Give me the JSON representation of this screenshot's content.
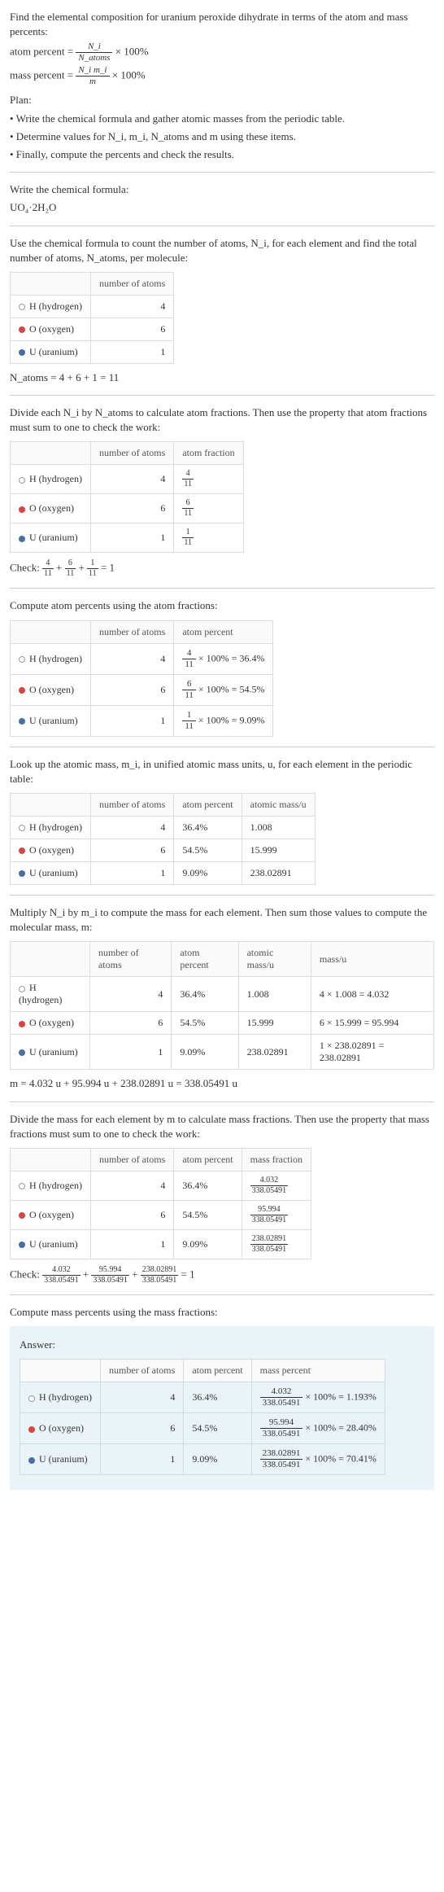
{
  "intro": {
    "prompt": "Find the elemental composition for uranium peroxide dihydrate in terms of the atom and mass percents:",
    "atom_eq_label": "atom percent = ",
    "atom_eq_num": "N_i",
    "atom_eq_den": "N_atoms",
    "times100": " × 100%",
    "mass_eq_label": "mass percent = ",
    "mass_eq_num": "N_i m_i",
    "mass_eq_den": "m"
  },
  "plan": {
    "heading": "Plan:",
    "b1": "• Write the chemical formula and gather atomic masses from the periodic table.",
    "b2": "• Determine values for N_i, m_i, N_atoms and m using these items.",
    "b3": "• Finally, compute the percents and check the results."
  },
  "step1": {
    "heading": "Write the chemical formula:",
    "formula": "UO₄·2H₂O"
  },
  "step2": {
    "text": "Use the chemical formula to count the number of atoms, N_i, for each element and find the total number of atoms, N_atoms, per molecule:",
    "col1": "number of atoms",
    "h_label": "H (hydrogen)",
    "o_label": "O (oxygen)",
    "u_label": "U (uranium)",
    "h_n": "4",
    "o_n": "6",
    "u_n": "1",
    "sum": "N_atoms = 4 + 6 + 1 = 11"
  },
  "step3": {
    "text": "Divide each N_i by N_atoms to calculate atom fractions. Then use the property that atom fractions must sum to one to check the work:",
    "col1": "number of atoms",
    "col2": "atom fraction",
    "h_n": "4",
    "h_num": "4",
    "h_den": "11",
    "o_n": "6",
    "o_num": "6",
    "o_den": "11",
    "u_n": "1",
    "u_num": "1",
    "u_den": "11",
    "check_label": "Check: ",
    "check_n1": "4",
    "check_d1": "11",
    "check_n2": "6",
    "check_d2": "11",
    "check_n3": "1",
    "check_d3": "11",
    "check_eq": " = 1"
  },
  "step4": {
    "text": "Compute atom percents using the atom fractions:",
    "col1": "number of atoms",
    "col2": "atom percent",
    "h_n": "4",
    "h_num": "4",
    "h_den": "11",
    "h_pct": " × 100% = 36.4%",
    "o_n": "6",
    "o_num": "6",
    "o_den": "11",
    "o_pct": " × 100% = 54.5%",
    "u_n": "1",
    "u_num": "1",
    "u_den": "11",
    "u_pct": " × 100% = 9.09%"
  },
  "step5": {
    "text": "Look up the atomic mass, m_i, in unified atomic mass units, u, for each element in the periodic table:",
    "col1": "number of atoms",
    "col2": "atom percent",
    "col3": "atomic mass/u",
    "h_n": "4",
    "h_pct": "36.4%",
    "h_m": "1.008",
    "o_n": "6",
    "o_pct": "54.5%",
    "o_m": "15.999",
    "u_n": "1",
    "u_pct": "9.09%",
    "u_m": "238.02891"
  },
  "step6": {
    "text": "Multiply N_i by m_i to compute the mass for each element. Then sum those values to compute the molecular mass, m:",
    "col1": "number of atoms",
    "col2": "atom percent",
    "col3": "atomic mass/u",
    "col4": "mass/u",
    "h_n": "4",
    "h_pct": "36.4%",
    "h_m": "1.008",
    "h_mass": "4 × 1.008 = 4.032",
    "o_n": "6",
    "o_pct": "54.5%",
    "o_m": "15.999",
    "o_mass": "6 × 15.999 = 95.994",
    "u_n": "1",
    "u_pct": "9.09%",
    "u_m": "238.02891",
    "u_mass": "1 × 238.02891 = 238.02891",
    "sum": "m = 4.032 u + 95.994 u + 238.02891 u = 338.05491 u"
  },
  "step7": {
    "text": "Divide the mass for each element by m to calculate mass fractions. Then use the property that mass fractions must sum to one to check the work:",
    "col1": "number of atoms",
    "col2": "atom percent",
    "col3": "mass fraction",
    "h_n": "4",
    "h_pct": "36.4%",
    "h_num": "4.032",
    "h_den": "338.05491",
    "o_n": "6",
    "o_pct": "54.5%",
    "o_num": "95.994",
    "o_den": "338.05491",
    "u_n": "1",
    "u_pct": "9.09%",
    "u_num": "238.02891",
    "u_den": "338.05491",
    "check_label": "Check: ",
    "check_n1": "4.032",
    "check_d1": "338.05491",
    "check_n2": "95.994",
    "check_d2": "338.05491",
    "check_n3": "238.02891",
    "check_d3": "338.05491",
    "check_eq": " = 1"
  },
  "step8": {
    "text": "Compute mass percents using the mass fractions:"
  },
  "answer": {
    "heading": "Answer:",
    "col1": "number of atoms",
    "col2": "atom percent",
    "col3": "mass percent",
    "h_n": "4",
    "h_pct": "36.4%",
    "h_num": "4.032",
    "h_den": "338.05491",
    "h_res": " × 100% = 1.193%",
    "o_n": "6",
    "o_pct": "54.5%",
    "o_num": "95.994",
    "o_den": "338.05491",
    "o_res": " × 100% = 28.40%",
    "u_n": "1",
    "u_pct": "9.09%",
    "u_num": "238.02891",
    "u_den": "338.05491",
    "u_res": " × 100% = 70.41%"
  },
  "elements": {
    "h": "H (hydrogen)",
    "o": "O (oxygen)",
    "u": "U (uranium)"
  },
  "plus": " + "
}
